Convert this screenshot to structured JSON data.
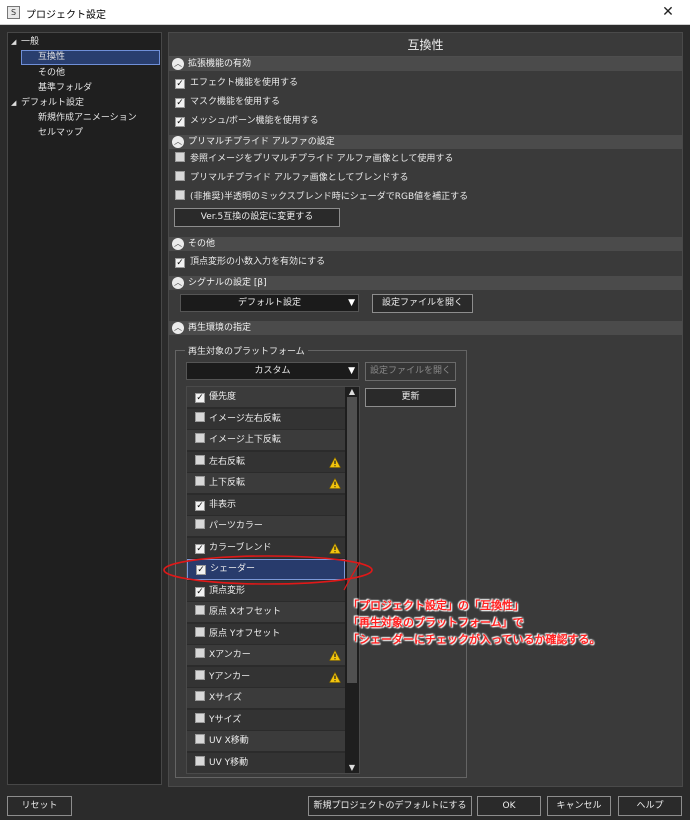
{
  "window": {
    "title": "プロジェクト設定",
    "close_glyph": "✕",
    "app_glyph": "S"
  },
  "tree": {
    "items": [
      {
        "label": "一般",
        "expanded": true
      },
      {
        "label": "互換性",
        "selected": true
      },
      {
        "label": "その他"
      },
      {
        "label": "基準フォルダ"
      },
      {
        "label": "デフォルト設定",
        "expanded": true
      },
      {
        "label": "新規作成アニメーション"
      },
      {
        "label": "セルマップ"
      }
    ]
  },
  "panel": {
    "title": "互換性",
    "sections": {
      "extension": {
        "label": "拡張機能の有効",
        "options": [
          {
            "label": "エフェクト機能を使用する",
            "checked": true
          },
          {
            "label": "マスク機能を使用する",
            "checked": true
          },
          {
            "label": "メッシュ/ボーン機能を使用する",
            "checked": true
          }
        ]
      },
      "premultiplied": {
        "label": "プリマルチプライド アルファの設定",
        "options": [
          {
            "label": "参照イメージをプリマルチプライド アルファ画像として使用する",
            "checked": false
          },
          {
            "label": "プリマルチプライド アルファ画像としてブレンドする",
            "checked": false
          },
          {
            "label": "(非推奨)半透明のミックスブレンド時にシェーダでRGB値を補正する",
            "checked": false
          }
        ],
        "button": "Ver.5互換の設定に変更する"
      },
      "other": {
        "label": "その他",
        "options": [
          {
            "label": "頂点変形の小数入力を有効にする",
            "checked": true
          }
        ]
      },
      "signal": {
        "label": "シグナルの設定 [β]",
        "combo": "デフォルト設定",
        "button": "設定ファイルを開く"
      },
      "playback": {
        "label": "再生環境の指定",
        "group_label": "再生対象のプラットフォーム",
        "combo": "カスタム",
        "open_button": "設定ファイルを開く",
        "update_button": "更新",
        "items": [
          {
            "label": "優先度",
            "checked": true,
            "warn": false
          },
          {
            "label": "イメージ左右反転",
            "checked": false,
            "warn": false
          },
          {
            "label": "イメージ上下反転",
            "checked": false,
            "warn": false
          },
          {
            "label": "左右反転",
            "checked": false,
            "warn": true
          },
          {
            "label": "上下反転",
            "checked": false,
            "warn": true
          },
          {
            "label": "非表示",
            "checked": true,
            "warn": false
          },
          {
            "label": "パーツカラー",
            "checked": false,
            "warn": false
          },
          {
            "label": "カラーブレンド",
            "checked": true,
            "warn": true
          },
          {
            "label": "シェーダー",
            "checked": true,
            "warn": false,
            "selected": true
          },
          {
            "label": "頂点変形",
            "checked": true,
            "warn": false
          },
          {
            "label": "原点 Xオフセット",
            "checked": false,
            "warn": false
          },
          {
            "label": "原点 Yオフセット",
            "checked": false,
            "warn": false
          },
          {
            "label": "Xアンカー",
            "checked": false,
            "warn": true
          },
          {
            "label": "Yアンカー",
            "checked": false,
            "warn": true
          },
          {
            "label": "Xサイズ",
            "checked": false,
            "warn": false
          },
          {
            "label": "Yサイズ",
            "checked": false,
            "warn": false
          },
          {
            "label": "UV X移動",
            "checked": false,
            "warn": false
          },
          {
            "label": "UV Y移動",
            "checked": false,
            "warn": false
          }
        ]
      }
    }
  },
  "annotation": {
    "lines": [
      "「プロジェクト設定」の「互換性」",
      "「再生対象のプラットフォーム」で",
      "「シェーダーにチェックが入っているか確認する。"
    ],
    "color": "#ff2020"
  },
  "footer": {
    "reset": "リセット",
    "make_default": "新規プロジェクトのデフォルトにする",
    "ok": "OK",
    "cancel": "キャンセル",
    "help": "ヘルプ"
  },
  "colors": {
    "background": "#2b2b2b",
    "panel": "#3a3a3a",
    "selection": "#283b6c",
    "selection_border": "#7b98d8"
  }
}
